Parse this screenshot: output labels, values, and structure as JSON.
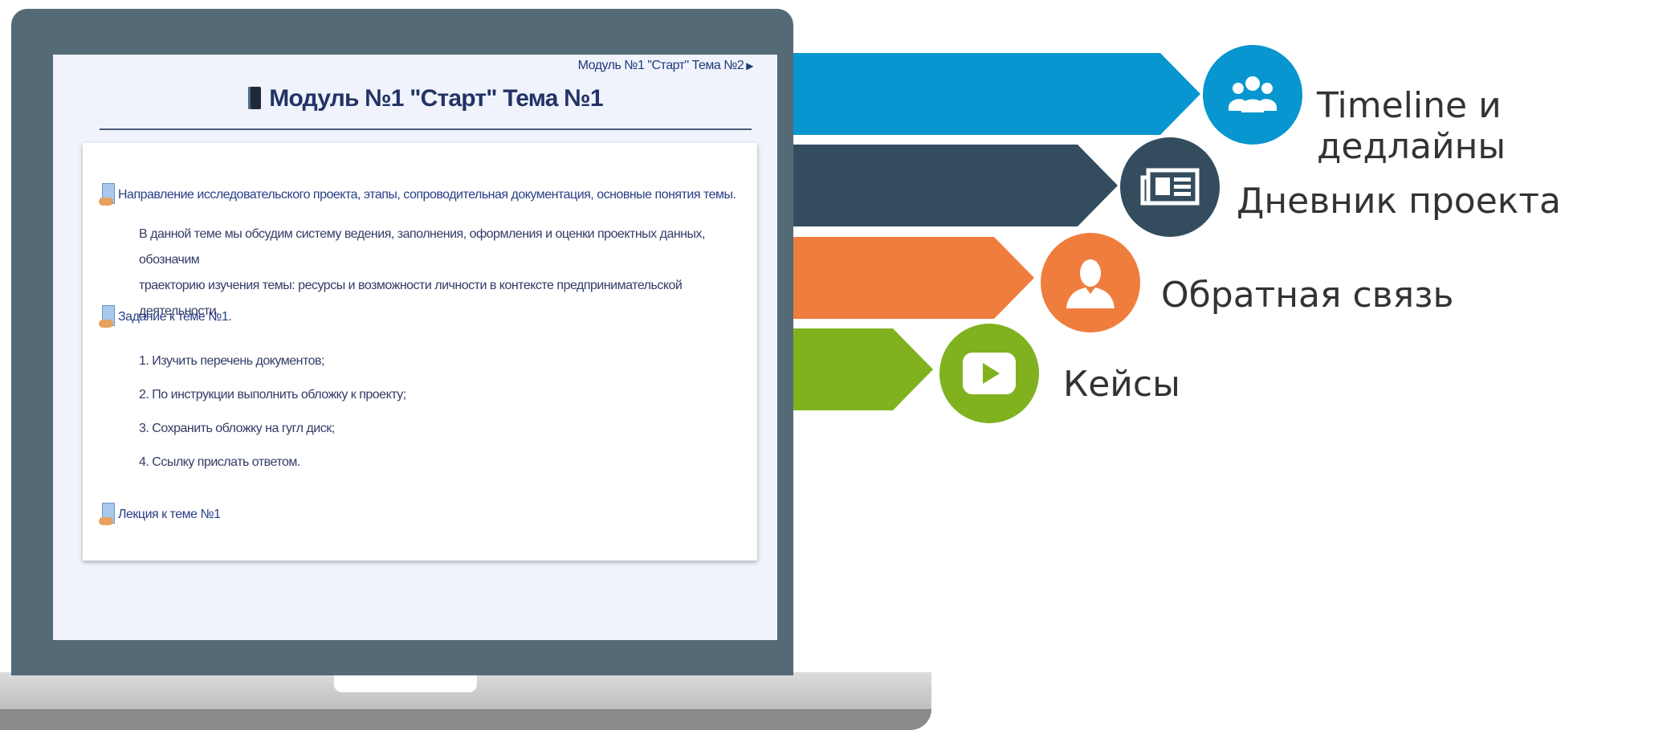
{
  "screen": {
    "nav_link": "Модуль №1 \"Старт\" Тема №2",
    "title": "Модуль №1 \"Старт\" Тема №1",
    "sections": [
      {
        "label": "Направление исследовательского проекта, этапы, сопроводительная документация, основные понятия темы."
      },
      {
        "label": "Задание к теме №1."
      },
      {
        "label": "Лекция к теме №1"
      }
    ],
    "description_line1": "В данной теме мы обсудим систему ведения, заполнения, оформления и оценки проектных данных, обозначим",
    "description_line2": "траекторию изучения темы: ресурсы и возможности личности в контексте предпринимательской деятельности.",
    "tasks": [
      "1. Изучить перечень документов;",
      "2. По инструкции выполнить обложку к проекту;",
      "3. Сохранить обложку на гугл диск;",
      "4. Ссылку прислать ответом."
    ]
  },
  "features": [
    {
      "label": "Timeline и дедлайны",
      "icon": "users-icon",
      "color": "#0796cf"
    },
    {
      "label": "Дневник проекта",
      "icon": "newspaper-icon",
      "color": "#334d5f"
    },
    {
      "label": "Обратная связь",
      "icon": "person-icon",
      "color": "#ef7d3e"
    },
    {
      "label": "Кейсы",
      "icon": "play-icon",
      "color": "#7fb21e"
    }
  ]
}
